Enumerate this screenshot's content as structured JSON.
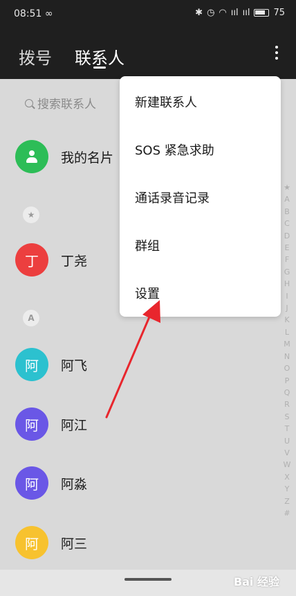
{
  "status": {
    "time": "08:51",
    "indicator": "∞",
    "icons": [
      "bluetooth-icon",
      "alarm-icon",
      "wifi-icon",
      "signal-icon",
      "battery-icon"
    ],
    "signal1": "ııl",
    "signal2": "ııl",
    "battery_level": "75"
  },
  "tabs": {
    "dial": "拨号",
    "contacts": "联系人"
  },
  "search": {
    "placeholder": "搜索联系人"
  },
  "contacts": [
    {
      "name": "我的名片",
      "avatar": "",
      "color": "#2dbd57"
    },
    {
      "section": "★"
    },
    {
      "name": "丁尧",
      "avatar": "丁",
      "color": "#ec3f3f"
    },
    {
      "section": "A"
    },
    {
      "name": "阿飞",
      "avatar": "阿",
      "color": "#2cc1cf"
    },
    {
      "name": "阿江",
      "avatar": "阿",
      "color": "#6a57e6"
    },
    {
      "name": "阿淼",
      "avatar": "阿",
      "color": "#6a57e6"
    },
    {
      "name": "阿三",
      "avatar": "阿",
      "color": "#f7c22f"
    }
  ],
  "alphabet": [
    "★",
    "A",
    "B",
    "C",
    "D",
    "E",
    "F",
    "G",
    "H",
    "I",
    "J",
    "K",
    "L",
    "M",
    "N",
    "O",
    "P",
    "Q",
    "R",
    "S",
    "T",
    "U",
    "V",
    "W",
    "X",
    "Y",
    "Z",
    "#"
  ],
  "menu": {
    "items": [
      "新建联系人",
      "SOS 紧急求助",
      "通话录音记录",
      "群组",
      "设置"
    ]
  },
  "watermark": "Bai 经验",
  "colors": {
    "arrow": "#e8262d",
    "topbar": "#1f1f1f"
  }
}
